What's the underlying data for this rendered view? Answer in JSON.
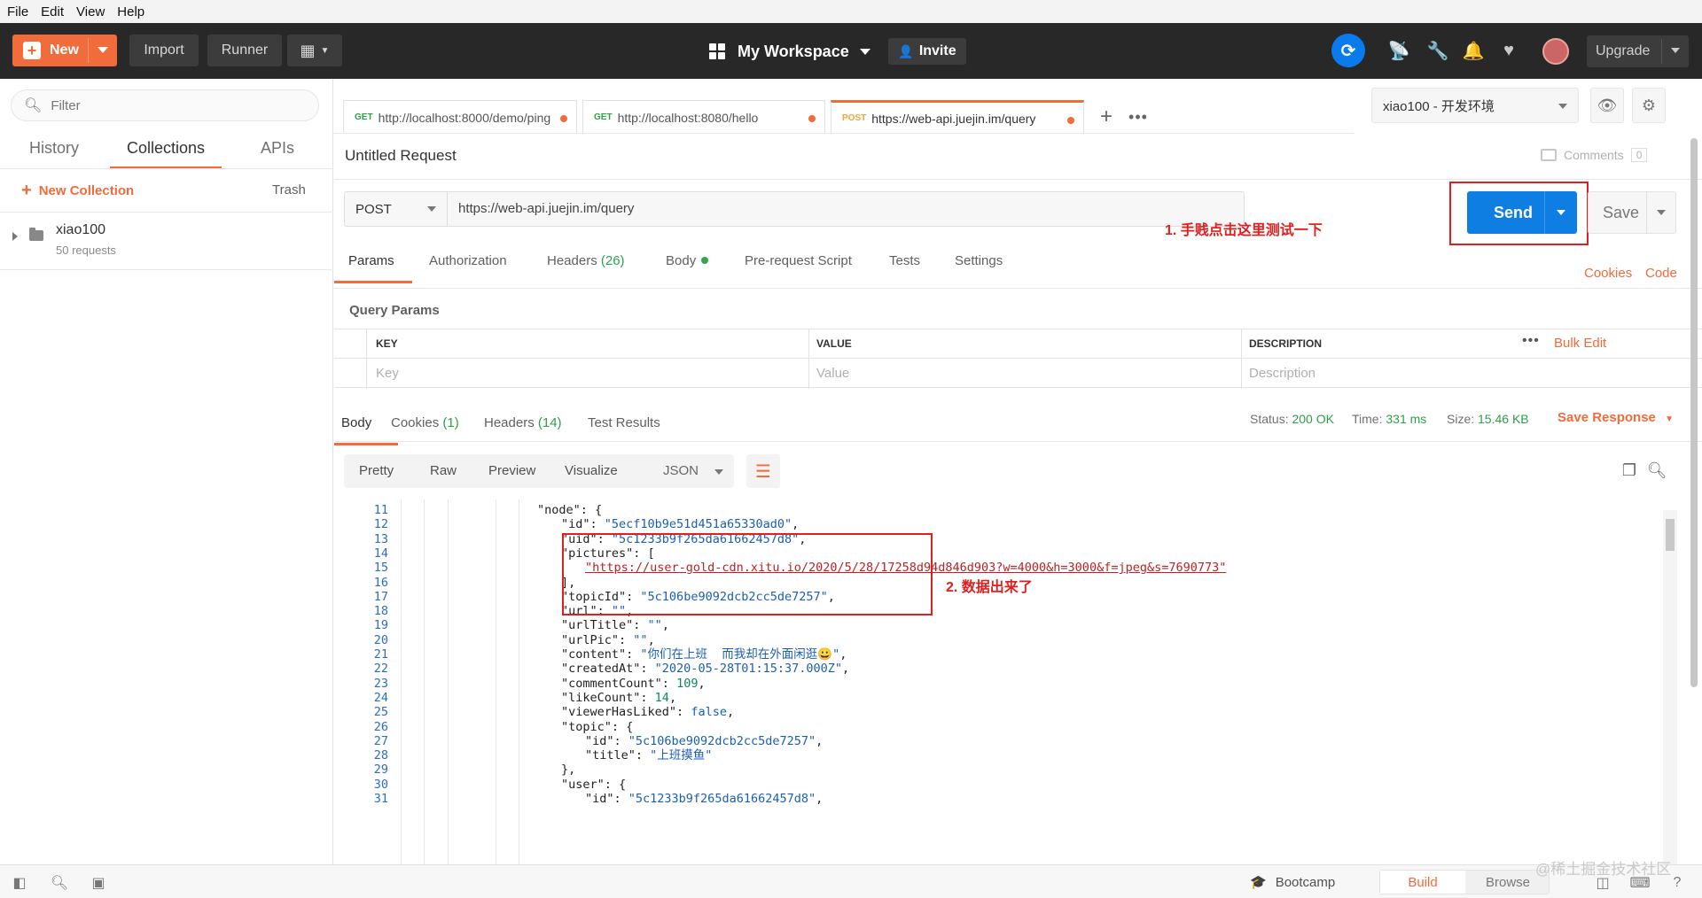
{
  "menu": [
    "File",
    "Edit",
    "View",
    "Help"
  ],
  "toolbar": {
    "new_label": "New",
    "import_label": "Import",
    "runner_label": "Runner",
    "workspace_label": "My Workspace",
    "invite_label": "Invite",
    "upgrade_label": "Upgrade"
  },
  "sidebar": {
    "filter_placeholder": "Filter",
    "tabs": [
      "History",
      "Collections",
      "APIs"
    ],
    "active_tab": "Collections",
    "new_collection_label": "New Collection",
    "trash_label": "Trash",
    "collection": {
      "name": "xiao100",
      "count": "50 requests"
    }
  },
  "request_tabs": [
    {
      "method": "GET",
      "url": "http://localhost:8000/demo/ping"
    },
    {
      "method": "GET",
      "url": "http://localhost:8080/hello"
    },
    {
      "method": "POST",
      "url": "https://web-api.juejin.im/query"
    }
  ],
  "environment": "xiao100 - 开发环境",
  "request": {
    "title": "Untitled Request",
    "comments_label": "Comments",
    "comments_count": "0",
    "method": "POST",
    "url": "https://web-api.juejin.im/query",
    "send_label": "Send",
    "save_label": "Save"
  },
  "annotations": {
    "one": "1. 手贱点击这里测试一下",
    "two": "2. 数据出来了"
  },
  "request_subtabs": {
    "params": "Params",
    "authorization": "Authorization",
    "headers": "Headers",
    "headers_count": "(26)",
    "body": "Body",
    "prerequest": "Pre-request Script",
    "tests": "Tests",
    "settings": "Settings",
    "cookies": "Cookies",
    "code": "Code"
  },
  "params": {
    "title": "Query Params",
    "col_key": "KEY",
    "col_value": "VALUE",
    "col_desc": "DESCRIPTION",
    "bulk_edit": "Bulk Edit",
    "ph_key": "Key",
    "ph_value": "Value",
    "ph_desc": "Description"
  },
  "response": {
    "tabs": {
      "body": "Body",
      "cookies": "Cookies",
      "cookies_count": "(1)",
      "headers": "Headers",
      "headers_count": "(14)",
      "tests": "Test Results"
    },
    "status_label": "Status:",
    "status": "200 OK",
    "time_label": "Time:",
    "time": "331 ms",
    "size_label": "Size:",
    "size": "15.46 KB",
    "save_response": "Save Response",
    "formats": [
      "Pretty",
      "Raw",
      "Preview",
      "Visualize"
    ],
    "format_type": "JSON"
  },
  "code_lines": [
    {
      "n": "11",
      "indent": 1,
      "html": "<span class='k'>\"node\"</span>: {"
    },
    {
      "n": "12",
      "indent": 2,
      "html": "<span class='k'>\"id\"</span>: <span class='s'>\"5ecf10b9e51d451a65330ad0\"</span>,"
    },
    {
      "n": "13",
      "indent": 2,
      "html": "<span class='k'>\"uid\"</span>: <span class='s'>\"5c1233b9f265da61662457d8\"</span>,"
    },
    {
      "n": "14",
      "indent": 2,
      "html": "<span class='k'>\"pictures\"</span>: ["
    },
    {
      "n": "15",
      "indent": 3,
      "html": "<span class='u'>\"https://user-gold-cdn.xitu.io/2020/5/28/17258d94d846d903?w=4000&amp;h=3000&amp;f=jpeg&amp;s=7690773\"</span>"
    },
    {
      "n": "16",
      "indent": 2,
      "html": "],"
    },
    {
      "n": "17",
      "indent": 2,
      "html": "<span class='k'>\"topicId\"</span>: <span class='s'>\"5c106be9092dcb2cc5de7257\"</span>,"
    },
    {
      "n": "18",
      "indent": 2,
      "html": "<span class='k'>\"url\"</span>: <span class='s'>\"\"</span>,"
    },
    {
      "n": "19",
      "indent": 2,
      "html": "<span class='k'>\"urlTitle\"</span>: <span class='s'>\"\"</span>,"
    },
    {
      "n": "20",
      "indent": 2,
      "html": "<span class='k'>\"urlPic\"</span>: <span class='s'>\"\"</span>,"
    },
    {
      "n": "21",
      "indent": 2,
      "html": "<span class='k'>\"content\"</span>: <span class='s'>\"你们在上班  而我却在外面闲逛😀\"</span>,"
    },
    {
      "n": "22",
      "indent": 2,
      "html": "<span class='k'>\"createdAt\"</span>: <span class='s'>\"2020-05-28T01:15:37.000Z\"</span>,"
    },
    {
      "n": "23",
      "indent": 2,
      "html": "<span class='k'>\"commentCount\"</span>: <span class='n'>109</span>,"
    },
    {
      "n": "24",
      "indent": 2,
      "html": "<span class='k'>\"likeCount\"</span>: <span class='n'>14</span>,"
    },
    {
      "n": "25",
      "indent": 2,
      "html": "<span class='k'>\"viewerHasLiked\"</span>: <span class='b'>false</span>,"
    },
    {
      "n": "26",
      "indent": 2,
      "html": "<span class='k'>\"topic\"</span>: {"
    },
    {
      "n": "27",
      "indent": 3,
      "html": "<span class='k'>\"id\"</span>: <span class='s'>\"5c106be9092dcb2cc5de7257\"</span>,"
    },
    {
      "n": "28",
      "indent": 3,
      "html": "<span class='k'>\"title\"</span>: <span class='s'>\"上班摸鱼\"</span>"
    },
    {
      "n": "29",
      "indent": 2,
      "html": "},"
    },
    {
      "n": "30",
      "indent": 2,
      "html": "<span class='k'>\"user\"</span>: {"
    },
    {
      "n": "31",
      "indent": 3,
      "html": "<span class='k'>\"id\"</span>: <span class='s'>\"5c1233b9f265da61662457d8\"</span>,"
    }
  ],
  "statusbar": {
    "bootcamp": "Bootcamp",
    "build": "Build",
    "browse": "Browse"
  },
  "watermark": "@稀土掘金技术社区",
  "colors": {
    "accent": "#f26b3a",
    "send": "#0e7ee3",
    "annotation": "#e02020"
  }
}
